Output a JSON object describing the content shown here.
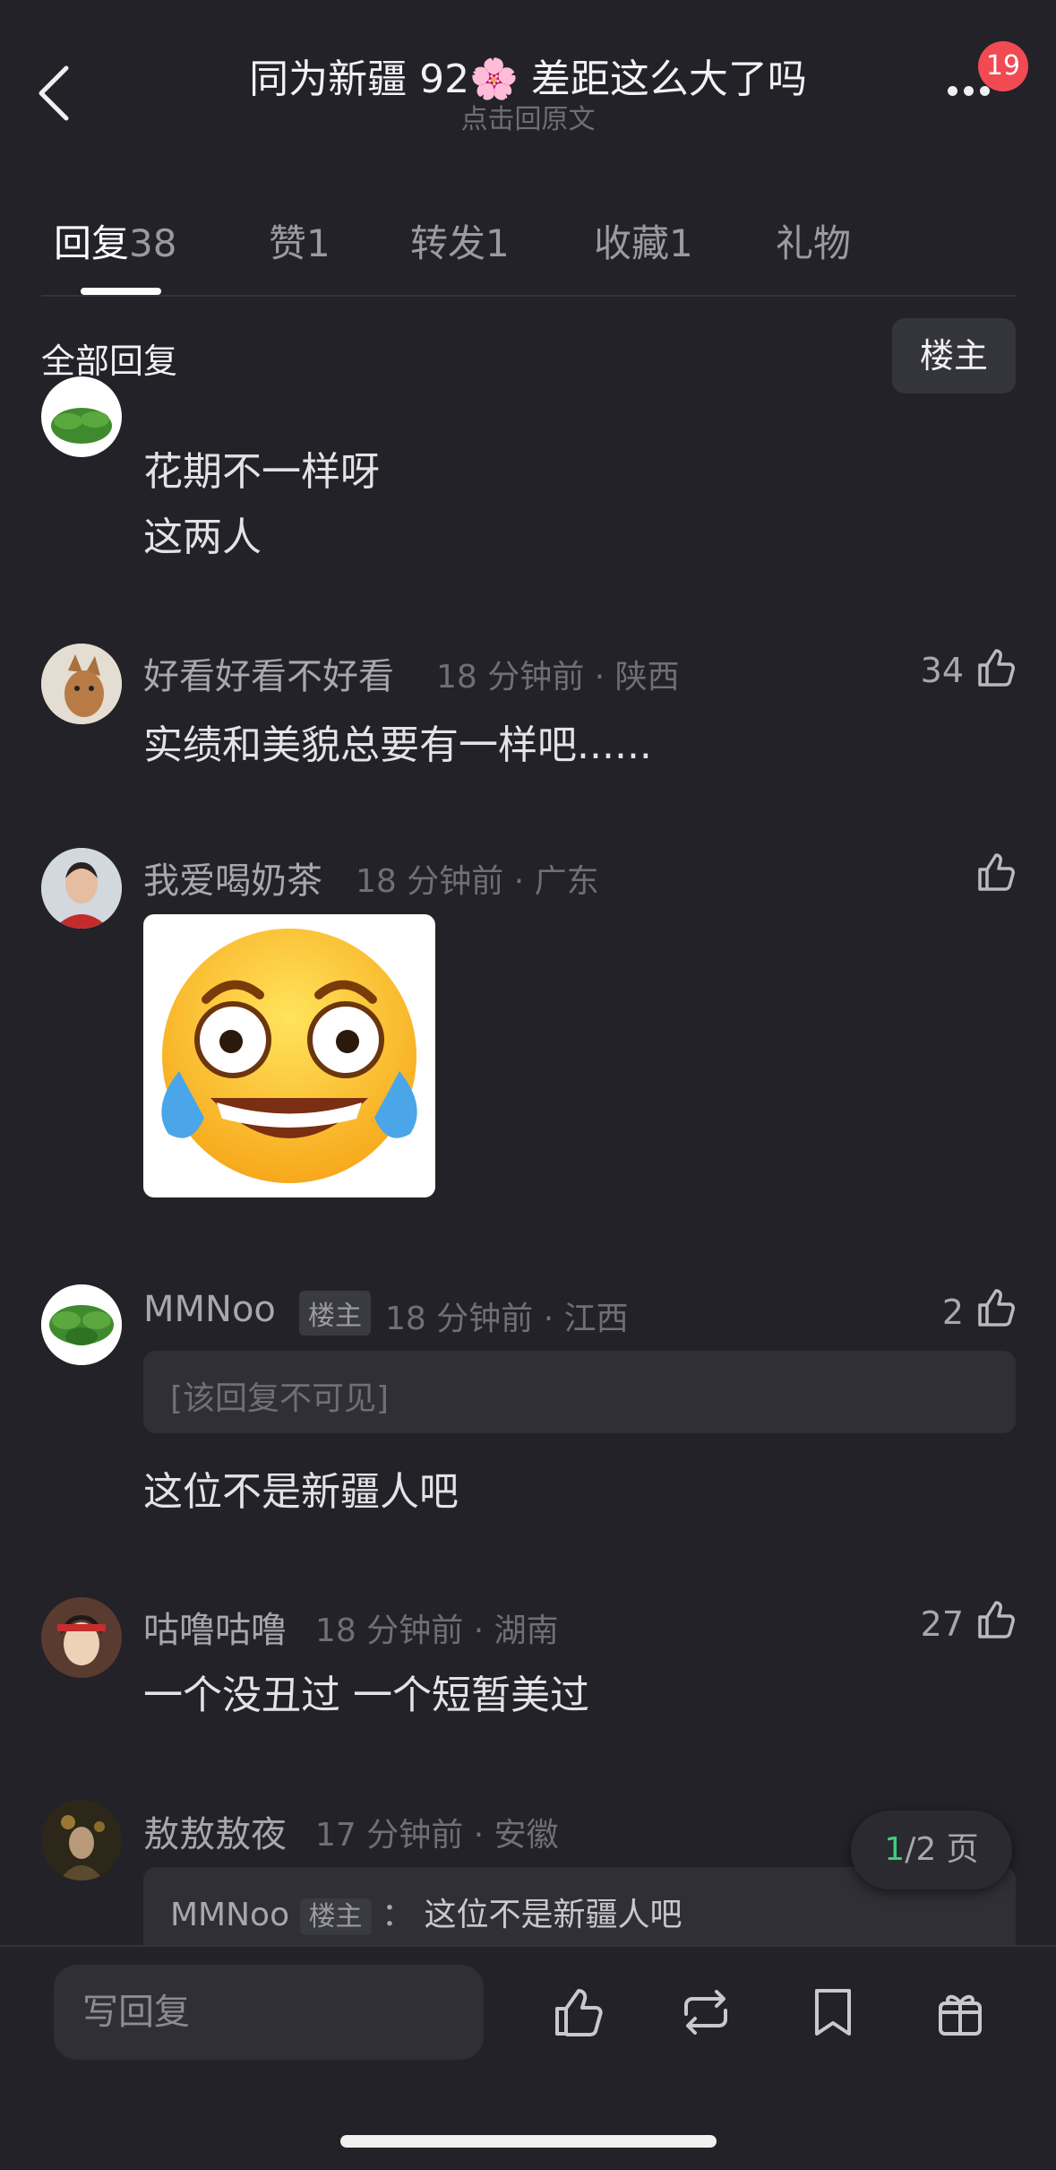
{
  "header": {
    "title": "同为新疆 92🌸 差距这么大了吗",
    "subtitle": "点击回原文",
    "notification_count": "19"
  },
  "tabs": [
    {
      "label": "回复",
      "count": "38",
      "active": true
    },
    {
      "label": "赞",
      "count": "1"
    },
    {
      "label": "转发",
      "count": "1"
    },
    {
      "label": "收藏",
      "count": "1"
    },
    {
      "label": "礼物",
      "count": ""
    }
  ],
  "filter": {
    "all_label": "全部回复",
    "owner_label": "楼主"
  },
  "comments": [
    {
      "avatar": "leaf-avatar",
      "lines": [
        "花期不一样呀",
        "这两人"
      ]
    },
    {
      "name": "好看好看不好看",
      "time": "18 分钟前 · 陕西",
      "likes": "34",
      "text": "实绩和美貌总要有一样吧......",
      "avatar": "cat-avatar"
    },
    {
      "name": "我爱喝奶茶",
      "time": "18 分钟前 · 广东",
      "likes": "",
      "image": "laughing-crying-emoji",
      "avatar": "person-avatar"
    },
    {
      "name": "MMNoo",
      "tag": "楼主",
      "time": "18 分钟前 · 江西",
      "likes": "2",
      "quote": "[该回复不可见]",
      "text": "这位不是新疆人吧",
      "avatar": "leaf-avatar"
    },
    {
      "name": "咕噜咕噜",
      "time": "18 分钟前 · 湖南",
      "likes": "27",
      "text": "一个没丑过 一个短暂美过",
      "avatar": "person-avatar-2"
    },
    {
      "name": "敖敖敖夜",
      "time": "17 分钟前 · 安徽",
      "quote_name": "MMNoo",
      "quote_tag": "楼主",
      "quote_sep": "：",
      "quote_text": "这位不是新疆人吧",
      "avatar": "person-avatar-3"
    }
  ],
  "pager": {
    "current": "1",
    "total": "/2 页"
  },
  "bottom_bar": {
    "reply_placeholder": "写回复",
    "icons": [
      "like-icon",
      "repost-icon",
      "bookmark-icon",
      "gift-icon"
    ]
  },
  "colors": {
    "background": "#222228",
    "accent_green": "#3ecf7a",
    "badge_red": "#f14a52"
  }
}
